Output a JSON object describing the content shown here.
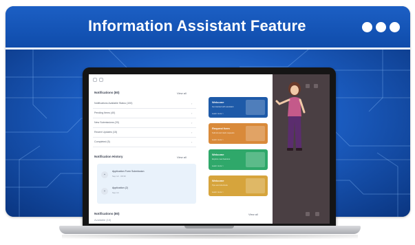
{
  "header": {
    "title": "Information Assistant Feature",
    "menu_icon": "more-dots-icon"
  },
  "colors": {
    "header_blue": "#1a5cc0",
    "card_blue": "#1e5aa8",
    "card_orange": "#d98a3a",
    "card_green": "#2fa86a",
    "card_yellow": "#d6a43c",
    "side_panel": "#4a3f43"
  },
  "screen": {
    "left_sections": [
      {
        "title": "Notifications (80)",
        "link": "View all",
        "rows": [
          "Notifications Available Status (100)",
          "Pending Items (40)",
          "New Submissions (20)",
          "Recent Updates (15)",
          "Completed (5)"
        ]
      },
      {
        "title": "Notification History",
        "link": "View all",
        "items": [
          {
            "title": "Application Form Submission",
            "meta": "Sep 12 · 09:30"
          },
          {
            "title": "Application (2)",
            "meta": "Sep 14"
          }
        ]
      },
      {
        "title": "Notifications (80)",
        "link": "View all",
        "rows": [
          "Available (10)"
        ]
      }
    ],
    "cards": [
      {
        "title": "Welcome",
        "subtitle": "Get started with assistant",
        "cta": "Learn more >",
        "color_key": "card_blue"
      },
      {
        "title": "Request form",
        "subtitle": "Submit and track requests",
        "cta": "Learn more >",
        "color_key": "card_orange"
      },
      {
        "title": "Welcome",
        "subtitle": "Explore new features",
        "cta": "Learn more >",
        "color_key": "card_green"
      },
      {
        "title": "Welcome",
        "subtitle": "Tips and shortcuts",
        "cta": "Learn more >",
        "color_key": "card_yellow"
      }
    ]
  }
}
